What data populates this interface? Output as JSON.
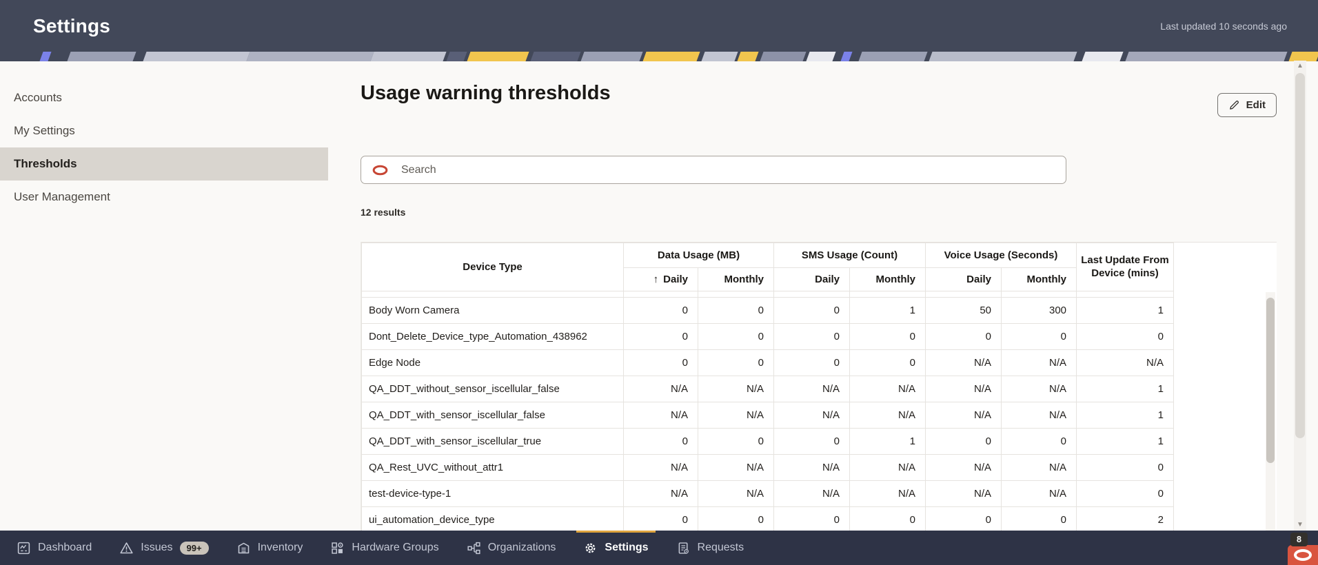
{
  "header": {
    "title": "Settings",
    "last_updated": "Last updated 10 seconds ago"
  },
  "sidebar": {
    "items": [
      {
        "label": "Accounts",
        "selected": false
      },
      {
        "label": "My Settings",
        "selected": false
      },
      {
        "label": "Thresholds",
        "selected": true
      },
      {
        "label": "User Management",
        "selected": false
      }
    ]
  },
  "main": {
    "title": "Usage warning thresholds",
    "edit_button": "Edit",
    "search_placeholder": "Search",
    "results_count": "12 results",
    "table": {
      "col_device": "Device Type",
      "groups": [
        {
          "label": "Data Usage (MB)"
        },
        {
          "label": "SMS Usage (Count)"
        },
        {
          "label": "Voice Usage (Seconds)"
        }
      ],
      "sub_daily": "Daily",
      "sub_monthly": "Monthly",
      "sort_arrow": "↑",
      "col_last_update": "Last Update From Device (mins)",
      "rows": [
        {
          "device": "Body Worn Camera",
          "values": [
            "0",
            "0",
            "0",
            "1",
            "50",
            "300",
            "1"
          ]
        },
        {
          "device": "Dont_Delete_Device_type_Automation_438962",
          "values": [
            "0",
            "0",
            "0",
            "0",
            "0",
            "0",
            "0"
          ]
        },
        {
          "device": "Edge Node",
          "values": [
            "0",
            "0",
            "0",
            "0",
            "N/A",
            "N/A",
            "N/A"
          ]
        },
        {
          "device": "QA_DDT_without_sensor_iscellular_false",
          "values": [
            "N/A",
            "N/A",
            "N/A",
            "N/A",
            "N/A",
            "N/A",
            "1"
          ]
        },
        {
          "device": "QA_DDT_with_sensor_iscellular_false",
          "values": [
            "N/A",
            "N/A",
            "N/A",
            "N/A",
            "N/A",
            "N/A",
            "1"
          ]
        },
        {
          "device": "QA_DDT_with_sensor_iscellular_true",
          "values": [
            "0",
            "0",
            "0",
            "1",
            "0",
            "0",
            "1"
          ]
        },
        {
          "device": "QA_Rest_UVC_without_attr1",
          "values": [
            "N/A",
            "N/A",
            "N/A",
            "N/A",
            "N/A",
            "N/A",
            "0"
          ]
        },
        {
          "device": "test-device-type-1",
          "values": [
            "N/A",
            "N/A",
            "N/A",
            "N/A",
            "N/A",
            "N/A",
            "0"
          ]
        },
        {
          "device": "ui_automation_device_type",
          "values": [
            "0",
            "0",
            "0",
            "0",
            "0",
            "0",
            "2"
          ]
        }
      ]
    }
  },
  "footer": {
    "items": [
      {
        "label": "Dashboard",
        "icon": "dashboard-icon",
        "selected": false
      },
      {
        "label": "Issues",
        "icon": "warning-triangle-icon",
        "badge": "99+",
        "selected": false
      },
      {
        "label": "Inventory",
        "icon": "inventory-box-icon",
        "selected": false
      },
      {
        "label": "Hardware Groups",
        "icon": "hardware-groups-icon",
        "selected": false
      },
      {
        "label": "Organizations",
        "icon": "org-hierarchy-icon",
        "selected": false
      },
      {
        "label": "Settings",
        "icon": "gear-icon",
        "selected": true
      },
      {
        "label": "Requests",
        "icon": "requests-doc-icon",
        "selected": false
      }
    ],
    "chat_badge": "8",
    "chat_icon": "oracle-o-icon"
  },
  "colors": {
    "header_bg": "#424859",
    "footer_bg": "#2e3346",
    "accent_orange": "#dfa43e",
    "oracle_red": "#c74634",
    "selected_sidebar_bg": "#d9d5cf",
    "launcher_red": "#d9543f"
  }
}
